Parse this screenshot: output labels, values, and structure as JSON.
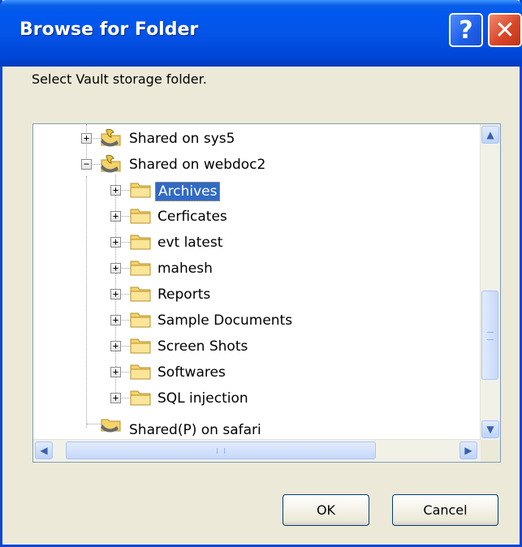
{
  "window": {
    "title": "Browse for Folder",
    "help_glyph": "?",
    "close_glyph": "✕"
  },
  "prompt": "Select Vault storage folder.",
  "tree": {
    "rows": [
      {
        "label": "Shared on sys5",
        "expander": "+",
        "icon": "shared-folder-icon",
        "selected": false
      },
      {
        "label": "Shared on webdoc2",
        "expander": "−",
        "icon": "shared-folder-icon",
        "selected": false
      },
      {
        "label": "Archives",
        "expander": "+",
        "icon": "folder-icon",
        "selected": true
      },
      {
        "label": "Cerficates",
        "expander": "+",
        "icon": "folder-icon",
        "selected": false
      },
      {
        "label": "evt latest",
        "expander": "+",
        "icon": "folder-icon",
        "selected": false
      },
      {
        "label": "mahesh",
        "expander": "+",
        "icon": "folder-icon",
        "selected": false
      },
      {
        "label": "Reports",
        "expander": "+",
        "icon": "folder-icon",
        "selected": false
      },
      {
        "label": "Sample Documents",
        "expander": "+",
        "icon": "folder-icon",
        "selected": false
      },
      {
        "label": "Screen Shots",
        "expander": "+",
        "icon": "folder-icon",
        "selected": false
      },
      {
        "label": "Softwares",
        "expander": "+",
        "icon": "folder-icon",
        "selected": false
      },
      {
        "label": "SQL injection",
        "expander": "+",
        "icon": "folder-icon",
        "selected": false
      },
      {
        "label": "Shared(P) on safari",
        "expander": "",
        "icon": "shared-folder-icon",
        "selected": false
      }
    ]
  },
  "scrollbars": {
    "up": "▲",
    "down": "▼",
    "left": "◀",
    "right": "▶",
    "grip_h": "III",
    "grip_v": "≡"
  },
  "buttons": {
    "ok": "OK",
    "cancel": "Cancel"
  },
  "colors": {
    "title_bar": "#0054e3",
    "selection": "#316ac5",
    "dialog_bg": "#ece9d8",
    "folder": "#f4d36a"
  }
}
